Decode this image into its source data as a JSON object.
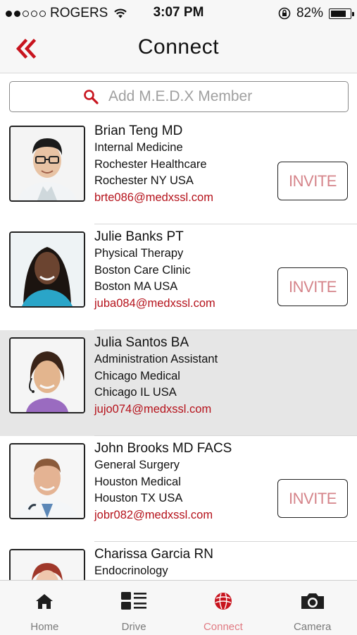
{
  "status_bar": {
    "carrier": "ROGERS",
    "time": "3:07 PM",
    "battery": "82%",
    "battery_level": 0.82,
    "signal_bars_filled": 2,
    "signal_bars_total": 5
  },
  "nav": {
    "title": "Connect",
    "back_icon": "double-chevron-left-icon"
  },
  "search": {
    "placeholder": "Add M.E.D.X Member",
    "value": ""
  },
  "members": [
    {
      "name": "Brian Teng MD",
      "specialty": "Internal Medicine",
      "organization": "Rochester Healthcare",
      "location": "Rochester NY USA",
      "email": "brte086@medxssl.com",
      "invite_label": "INVITE",
      "show_invite": true,
      "selected": false
    },
    {
      "name": "Julie Banks PT",
      "specialty": "Physical Therapy",
      "organization": "Boston Care Clinic",
      "location": "Boston MA USA",
      "email": "juba084@medxssl.com",
      "invite_label": "INVITE",
      "show_invite": true,
      "selected": false
    },
    {
      "name": "Julia Santos BA",
      "specialty": "Administration Assistant",
      "organization": "Chicago Medical",
      "location": "Chicago IL USA",
      "email": "jujo074@medxssl.com",
      "invite_label": "",
      "show_invite": false,
      "selected": true
    },
    {
      "name": "John Brooks MD FACS",
      "specialty": "General Surgery",
      "organization": "Houston Medical",
      "location": "Houston TX USA",
      "email": "jobr082@medxssl.com",
      "invite_label": "INVITE",
      "show_invite": true,
      "selected": false
    },
    {
      "name": "Charissa Garcia RN",
      "specialty": "Endocrinology",
      "organization": "",
      "location": "",
      "email": "",
      "invite_label": "",
      "show_invite": false,
      "selected": false
    }
  ],
  "tabs": [
    {
      "label": "Home",
      "icon": "home-icon",
      "active": false
    },
    {
      "label": "Drive",
      "icon": "list-icon",
      "active": false
    },
    {
      "label": "Connect",
      "icon": "globe-icon",
      "active": true
    },
    {
      "label": "Camera",
      "icon": "camera-icon",
      "active": false
    }
  ],
  "colors": {
    "accent": "#b5121b",
    "invite_text": "#d5848a",
    "active_tab": "#e07a82",
    "selected_row": "#e6e6e6"
  }
}
